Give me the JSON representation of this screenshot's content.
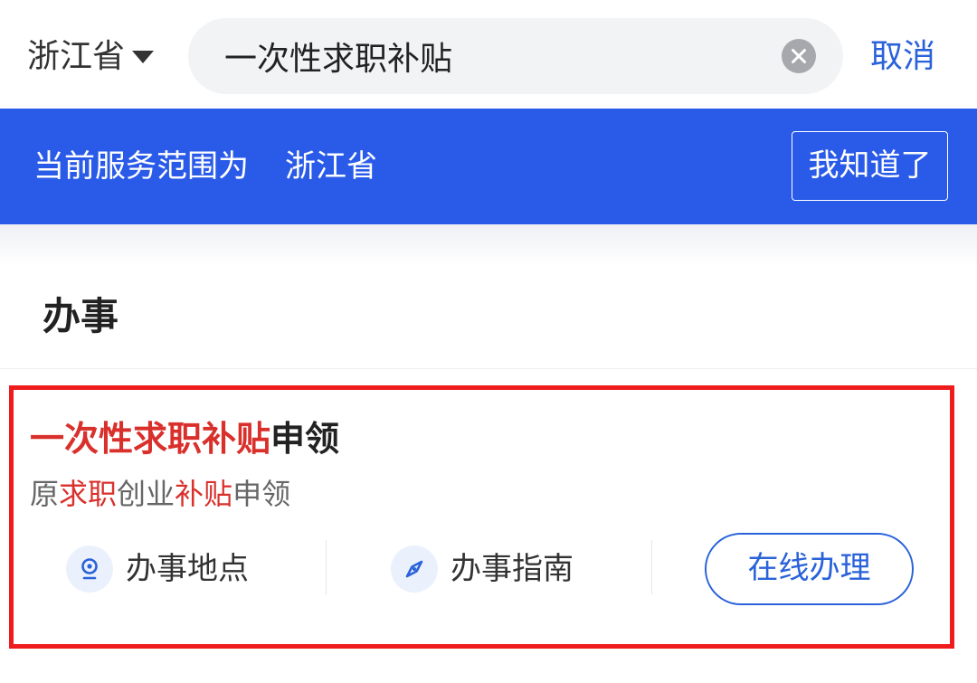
{
  "search": {
    "province": "浙江省",
    "query": "一次性求职补贴",
    "cancel_label": "取消"
  },
  "banner": {
    "prefix": "当前服务范围为",
    "scope": "浙江省",
    "dismiss_label": "我知道了"
  },
  "section": {
    "title": "办事"
  },
  "result": {
    "title_highlight": "一次性求职补贴",
    "title_rest": "申领",
    "subtitle_parts": [
      {
        "text": "原",
        "highlight": false
      },
      {
        "text": "求职",
        "highlight": true
      },
      {
        "text": "创业",
        "highlight": false
      },
      {
        "text": "补贴",
        "highlight": true
      },
      {
        "text": "申领",
        "highlight": false
      }
    ],
    "location_label": "办事地点",
    "guide_label": "办事指南",
    "online_label": "在线办理"
  },
  "colors": {
    "accent_blue": "#2a62d9",
    "banner_blue": "#2a5be8",
    "highlight_red": "#d9302c",
    "card_border_red": "#ee1c1c"
  },
  "icons": {
    "location": "location-pin-icon",
    "guide": "compass-icon",
    "clear": "clear-circle-icon",
    "dropdown": "caret-down-icon"
  }
}
